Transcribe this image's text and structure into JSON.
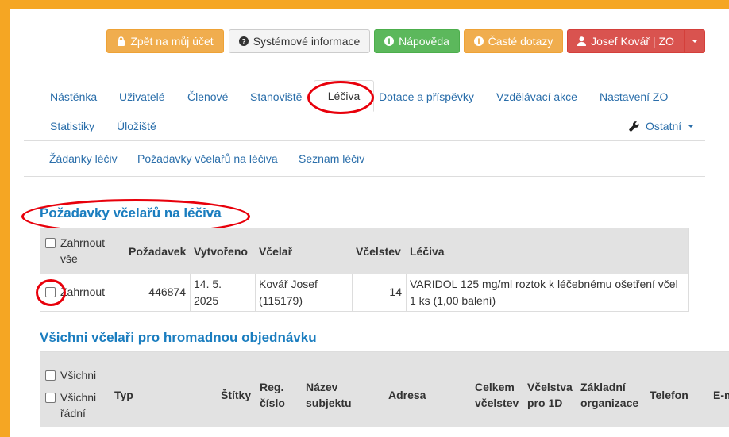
{
  "toolbar": {
    "back_label": "Zpět na můj účet",
    "sysinfo_label": "Systémové informace",
    "help_label": "Nápověda",
    "faq_label": "Časté dotazy",
    "user_label": "Josef Kovář | ZO"
  },
  "nav": {
    "items": [
      "Nástěnka",
      "Uživatelé",
      "Členové",
      "Stanoviště",
      "Léčiva",
      "Dotace a příspěvky",
      "Vzdělávací akce",
      "Nastavení ZO",
      "Statistiky",
      "Úložiště"
    ],
    "other_label": "Ostatní"
  },
  "subnav": {
    "items": [
      "Žádanky léčiv",
      "Požadavky včelařů na léčiva",
      "Seznam léčiv"
    ]
  },
  "section1": {
    "title": "Požadavky včelařů na léčiva",
    "headers": {
      "include_all_line1": "Zahrnout",
      "include_all_line2": "vše",
      "request": "Požadavek",
      "created": "Vytvořeno",
      "beekeeper": "Včelař",
      "colonies": "Včelstev",
      "medicines": "Léčiva"
    },
    "row": {
      "include": "Zahrnout",
      "request": "446874",
      "created_line1": "14. 5.",
      "created_line2": "2025",
      "beekeeper_line1": "Kovář Josef",
      "beekeeper_line2": "(115179)",
      "colonies": "14",
      "medicines_line1": "VARIDOL 125 mg/ml roztok k léčebnému ošetření včel",
      "medicines_line2": "1 ks (1,00 balení)"
    }
  },
  "section2": {
    "title": "Všichni včelaři pro hromadnou objednávku",
    "headers": {
      "all": "Všichni",
      "all_regular_line1": "Všichni",
      "all_regular_line2": "řádní",
      "type": "Typ",
      "tags": "Štítky",
      "reg_no_line1": "Reg.",
      "reg_no_line2": "číslo",
      "name_line1": "Název",
      "name_line2": "subjektu",
      "address": "Adresa",
      "total_line1": "Celkem",
      "total_line2": "včelstev",
      "for1d_line1": "Včelstva",
      "for1d_line2": "pro 1D",
      "org_line1": "Základní",
      "org_line2": "organizace",
      "phone": "Telefon",
      "email_partial": "E-m"
    }
  },
  "colors": {
    "frame": "#f5a623",
    "link": "#2a6eaa",
    "heading": "#1a7dbf",
    "highlight": "#e8000b"
  }
}
